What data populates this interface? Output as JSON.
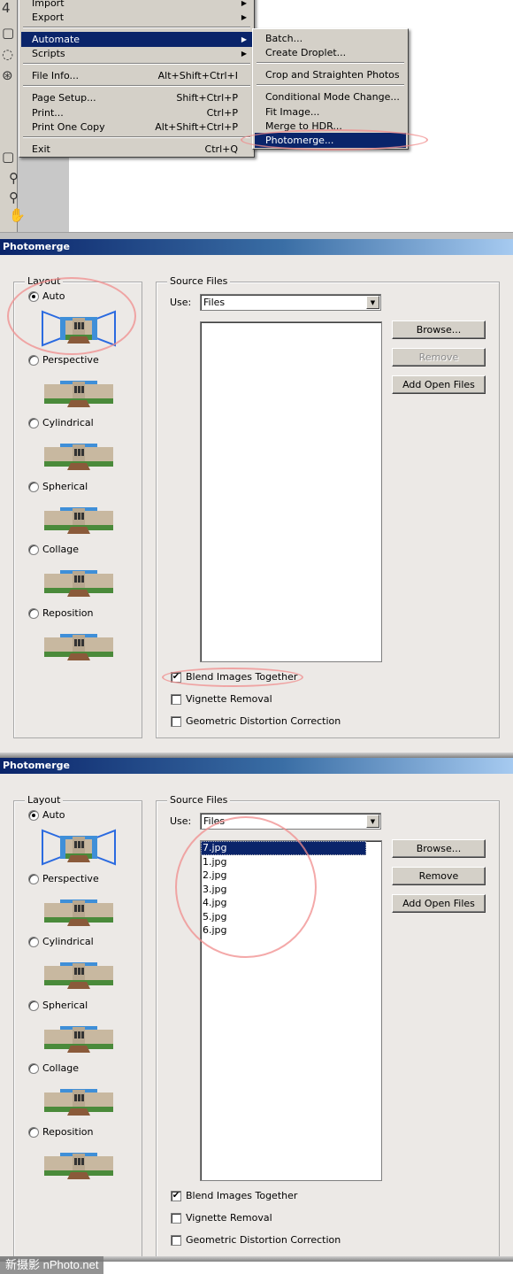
{
  "file_menu": {
    "items": [
      {
        "label": "Import",
        "shortcut": "",
        "submenu": true
      },
      {
        "label": "Export",
        "shortcut": "",
        "submenu": true
      },
      {
        "label": "Automate",
        "shortcut": "",
        "submenu": true,
        "highlighted": true
      },
      {
        "label": "Scripts",
        "shortcut": "",
        "submenu": true
      },
      {
        "label": "File Info...",
        "shortcut": "Alt+Shift+Ctrl+I"
      },
      {
        "label": "Page Setup...",
        "shortcut": "Shift+Ctrl+P"
      },
      {
        "label": "Print...",
        "shortcut": "Ctrl+P"
      },
      {
        "label": "Print One Copy",
        "shortcut": "Alt+Shift+Ctrl+P"
      },
      {
        "label": "Exit",
        "shortcut": "Ctrl+Q"
      }
    ]
  },
  "automate_menu": {
    "items": [
      {
        "label": "Batch..."
      },
      {
        "label": "Create Droplet..."
      },
      {
        "label": "Crop and Straighten Photos"
      },
      {
        "label": "Conditional Mode Change..."
      },
      {
        "label": "Fit Image..."
      },
      {
        "label": "Merge to HDR..."
      },
      {
        "label": "Photomerge...",
        "highlighted": true
      }
    ]
  },
  "dialogs": [
    {
      "title": "Photomerge",
      "layout_label": "Layout",
      "layout_options": [
        {
          "label": "Auto",
          "selected": true
        },
        {
          "label": "Perspective",
          "selected": false
        },
        {
          "label": "Cylindrical",
          "selected": false
        },
        {
          "label": "Spherical",
          "selected": false
        },
        {
          "label": "Collage",
          "selected": false
        },
        {
          "label": "Reposition",
          "selected": false
        }
      ],
      "source_files_label": "Source Files",
      "use_label": "Use:",
      "use_value": "Files",
      "files": [],
      "browse_label": "Browse...",
      "remove_label": "Remove",
      "remove_enabled": false,
      "add_open_files_label": "Add Open Files",
      "options": [
        {
          "label": "Blend Images Together",
          "checked": true
        },
        {
          "label": "Vignette Removal",
          "checked": false
        },
        {
          "label": "Geometric Distortion Correction",
          "checked": false
        }
      ]
    },
    {
      "title": "Photomerge",
      "layout_label": "Layout",
      "layout_options": [
        {
          "label": "Auto",
          "selected": true
        },
        {
          "label": "Perspective",
          "selected": false
        },
        {
          "label": "Cylindrical",
          "selected": false
        },
        {
          "label": "Spherical",
          "selected": false
        },
        {
          "label": "Collage",
          "selected": false
        },
        {
          "label": "Reposition",
          "selected": false
        }
      ],
      "source_files_label": "Source Files",
      "use_label": "Use:",
      "use_value": "Files",
      "files": [
        "7.jpg",
        "1.jpg",
        "2.jpg",
        "3.jpg",
        "4.jpg",
        "5.jpg",
        "6.jpg"
      ],
      "selected_file": "7.jpg",
      "browse_label": "Browse...",
      "remove_label": "Remove",
      "remove_enabled": true,
      "add_open_files_label": "Add Open Files",
      "options": [
        {
          "label": "Blend Images Together",
          "checked": true
        },
        {
          "label": "Vignette Removal",
          "checked": false
        },
        {
          "label": "Geometric Distortion Correction",
          "checked": false
        }
      ]
    }
  ],
  "watermark": "新摄影 nPhoto.net",
  "colors": {
    "menu_highlight": "#0a246a",
    "dialog_bg": "#ece9e6",
    "annotation": "#f08c8c"
  }
}
